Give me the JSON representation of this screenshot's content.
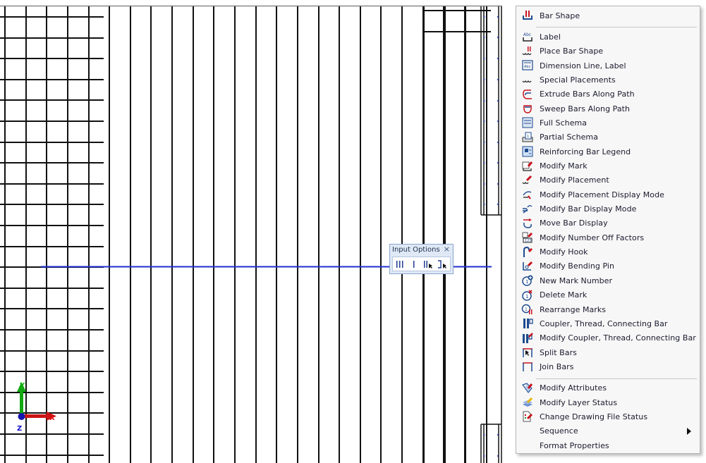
{
  "input_options": {
    "title": "Input Options",
    "close_glyph": "×",
    "buttons": [
      {
        "name": "multiple-bars-icon"
      },
      {
        "name": "single-bar-icon"
      },
      {
        "name": "bars-pick-icon"
      },
      {
        "name": "bracket-pick-icon"
      }
    ]
  },
  "axes": {
    "x_label": "X",
    "y_label": "Y",
    "z_label": "Z",
    "colors": {
      "x": "#e01010",
      "y": "#10b010",
      "z": "#1010d0"
    }
  },
  "colors": {
    "guide_line": "#1f2fd0",
    "menu_bg": "#f7f7f7",
    "icon_red": "#c8141e",
    "icon_blue": "#1e4b8f"
  },
  "menu": {
    "groups": [
      {
        "items": [
          {
            "label": "Bar Shape",
            "icon": "bar-shape-icon"
          }
        ]
      },
      {
        "items": [
          {
            "label": "Label",
            "icon": "label-icon"
          },
          {
            "label": "Place Bar Shape",
            "icon": "place-bar-shape-icon"
          },
          {
            "label": "Dimension Line, Label",
            "icon": "dimension-line-label-icon"
          },
          {
            "label": "Special Placements",
            "icon": "special-placements-icon"
          },
          {
            "label": "Extrude Bars Along Path",
            "icon": "extrude-bars-icon"
          },
          {
            "label": "Sweep Bars Along Path",
            "icon": "sweep-bars-icon"
          },
          {
            "label": "Full Schema",
            "icon": "full-schema-icon"
          },
          {
            "label": "Partial Schema",
            "icon": "partial-schema-icon"
          },
          {
            "label": "Reinforcing Bar Legend",
            "icon": "bar-legend-icon"
          },
          {
            "label": "Modify Mark",
            "icon": "modify-mark-icon"
          },
          {
            "label": "Modify Placement",
            "icon": "modify-placement-icon"
          },
          {
            "label": "Modify Placement Display Mode",
            "icon": "placement-display-mode-icon"
          },
          {
            "label": "Modify Bar Display Mode",
            "icon": "bar-display-mode-icon"
          },
          {
            "label": "Move Bar Display",
            "icon": "move-bar-display-icon"
          },
          {
            "label": "Modify Number Off Factors",
            "icon": "number-off-factors-icon"
          },
          {
            "label": "Modify Hook",
            "icon": "modify-hook-icon"
          },
          {
            "label": "Modify Bending Pin",
            "icon": "bending-pin-icon"
          },
          {
            "label": "New Mark Number",
            "icon": "new-mark-number-icon"
          },
          {
            "label": "Delete Mark",
            "icon": "delete-mark-icon"
          },
          {
            "label": "Rearrange Marks",
            "icon": "rearrange-marks-icon"
          },
          {
            "label": "Coupler, Thread, Connecting Bar",
            "icon": "coupler-icon"
          },
          {
            "label": "Modify Coupler, Thread, Connecting Bar",
            "icon": "modify-coupler-icon"
          },
          {
            "label": "Split Bars",
            "icon": "split-bars-icon"
          },
          {
            "label": "Join Bars",
            "icon": "join-bars-icon"
          }
        ]
      },
      {
        "items": [
          {
            "label": "Modify Attributes",
            "icon": "modify-attributes-icon"
          },
          {
            "label": "Modify Layer Status",
            "icon": "layer-status-icon"
          },
          {
            "label": "Change Drawing File Status",
            "icon": "drawing-file-status-icon"
          },
          {
            "label": "Sequence",
            "icon": "",
            "submenu": true
          },
          {
            "label": "Format Properties",
            "icon": ""
          }
        ]
      }
    ]
  }
}
